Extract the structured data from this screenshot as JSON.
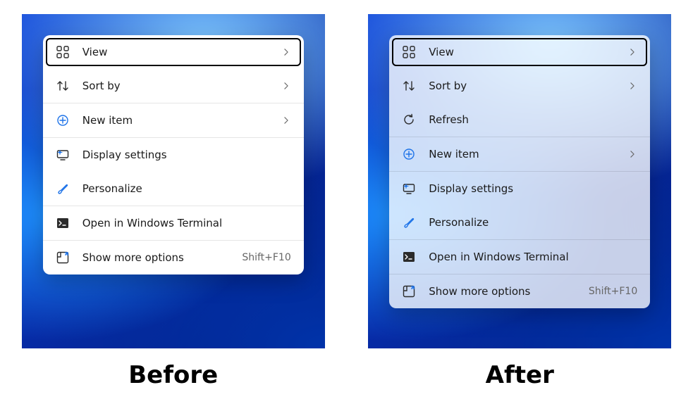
{
  "captions": {
    "before": "Before",
    "after": "After"
  },
  "before_menu": {
    "style": "opaque",
    "items": [
      {
        "id": "view",
        "label": "View",
        "icon": "grid-icon",
        "submenu": true,
        "focused": true
      },
      {
        "id": "sort",
        "label": "Sort by",
        "icon": "sort-icon",
        "submenu": true
      },
      {
        "divider": true
      },
      {
        "id": "new",
        "label": "New item",
        "icon": "plus-circle-icon",
        "submenu": true
      },
      {
        "divider": true
      },
      {
        "id": "display",
        "label": "Display settings",
        "icon": "display-settings-icon"
      },
      {
        "id": "personalize",
        "label": "Personalize",
        "icon": "brush-icon"
      },
      {
        "divider": true
      },
      {
        "id": "terminal",
        "label": "Open in Windows Terminal",
        "icon": "terminal-icon"
      },
      {
        "divider": true
      },
      {
        "id": "more",
        "label": "Show more options",
        "icon": "more-options-icon",
        "shortcut": "Shift+F10"
      }
    ]
  },
  "after_menu": {
    "style": "acrylic",
    "items": [
      {
        "id": "view",
        "label": "View",
        "icon": "grid-icon",
        "submenu": true,
        "focused": true
      },
      {
        "id": "sort",
        "label": "Sort by",
        "icon": "sort-icon",
        "submenu": true
      },
      {
        "id": "refresh",
        "label": "Refresh",
        "icon": "refresh-icon"
      },
      {
        "divider": true
      },
      {
        "id": "new",
        "label": "New item",
        "icon": "plus-circle-icon",
        "submenu": true
      },
      {
        "divider": true
      },
      {
        "id": "display",
        "label": "Display settings",
        "icon": "display-settings-icon"
      },
      {
        "id": "personalize",
        "label": "Personalize",
        "icon": "brush-icon"
      },
      {
        "divider": true
      },
      {
        "id": "terminal",
        "label": "Open in Windows Terminal",
        "icon": "terminal-icon"
      },
      {
        "divider": true
      },
      {
        "id": "more",
        "label": "Show more options",
        "icon": "more-options-icon",
        "shortcut": "Shift+F10"
      }
    ]
  }
}
